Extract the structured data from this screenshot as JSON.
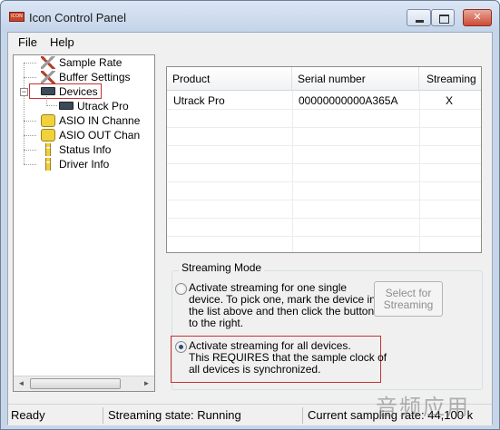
{
  "window": {
    "title": "Icon Control Panel",
    "icon_text": "ICON"
  },
  "titlebar_buttons": {
    "minimize": "minimize-button",
    "maximize": "maximize-button",
    "close": "close-button"
  },
  "menu": {
    "file": "File",
    "help": "Help"
  },
  "tree": {
    "items": [
      {
        "label": "Sample Rate",
        "icon": "tools-icon"
      },
      {
        "label": "Buffer Settings",
        "icon": "tools-icon"
      },
      {
        "label": "Devices",
        "icon": "device-icon",
        "expander": "−"
      },
      {
        "label": "Utrack Pro",
        "icon": "device-icon"
      },
      {
        "label": "ASIO IN Channe",
        "icon": "channel-icon"
      },
      {
        "label": "ASIO OUT Chan",
        "icon": "channel-icon"
      },
      {
        "label": "Status Info",
        "icon": "info-icon"
      },
      {
        "label": "Driver Info",
        "icon": "info-icon"
      }
    ],
    "scroll_left": "◄",
    "scroll_right": "►"
  },
  "devices_table": {
    "columns": [
      "Product",
      "Serial number",
      "Streaming"
    ],
    "rows": [
      {
        "product": "Utrack Pro",
        "serial": "00000000000A365A",
        "streaming": "X"
      }
    ]
  },
  "streaming_mode": {
    "title": "Streaming Mode",
    "option_single": {
      "line1": "Activate streaming for one single",
      "line2": "device. To pick one, mark the device in",
      "line3": "the list above and then click the button",
      "line4": "to the right.",
      "checked": false
    },
    "option_all": {
      "line1": "Activate streaming for all devices.",
      "line2": "This REQUIRES that the sample clock of",
      "line3": "all devices is synchronized.",
      "checked": true
    },
    "select_button": {
      "line1": "Select for",
      "line2": "Streaming"
    }
  },
  "status": {
    "ready": "Ready",
    "streaming_state": "Streaming state: Running",
    "sampling_rate": "Current sampling rate: 44,100 k"
  },
  "watermark": "音频应用",
  "colors": {
    "highlight": "#c83232",
    "titlebar": "#c4d4e9",
    "close_button": "#cd4b35"
  }
}
